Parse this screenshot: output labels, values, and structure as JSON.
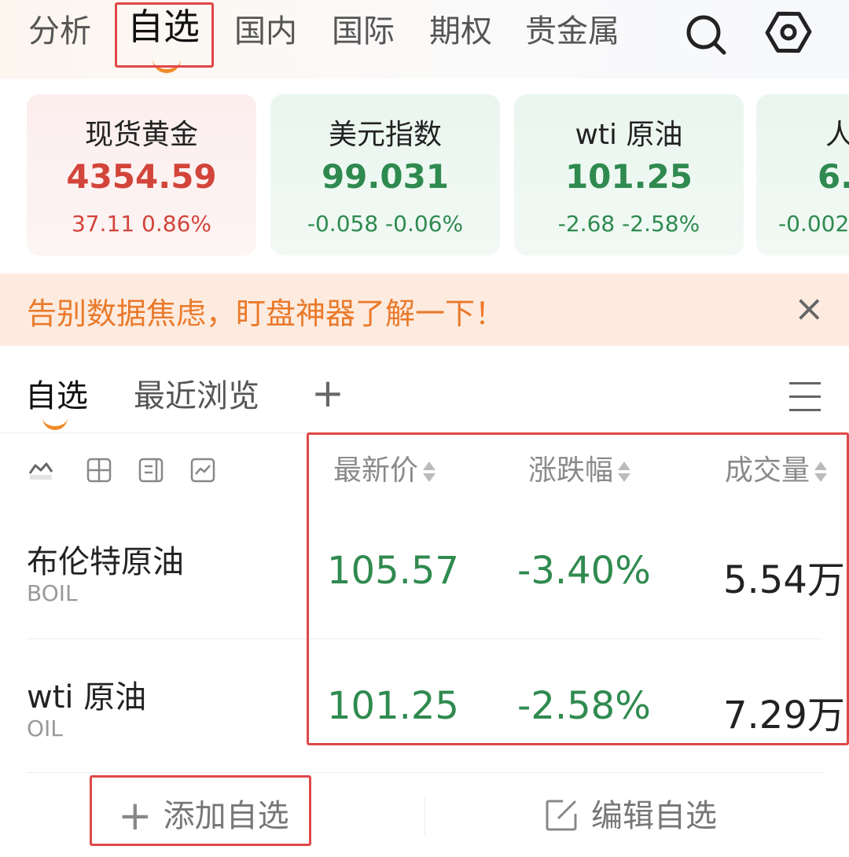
{
  "top_tabs": [
    {
      "label": "分析"
    },
    {
      "label": "自选"
    },
    {
      "label": "国内"
    },
    {
      "label": "国际"
    },
    {
      "label": "期权"
    },
    {
      "label": "贵金属"
    }
  ],
  "icons": {
    "search": "search-icon",
    "settings": "hexagon-settings-icon",
    "close": "close-icon",
    "menu": "menu-icon",
    "edit": "edit-icon"
  },
  "cards": [
    {
      "name": "现货黄金",
      "price": "4354.59",
      "change": "37.11  0.86%",
      "trend": "up"
    },
    {
      "name": "美元指数",
      "price": "99.031",
      "change": "-0.058  -0.06%",
      "trend": "down"
    },
    {
      "name": "wti 原油",
      "price": "101.25",
      "change": "-2.68  -2.58%",
      "trend": "down"
    },
    {
      "name": "人",
      "price": "6.",
      "change": "-0.002",
      "trend": "down"
    }
  ],
  "banner": {
    "text": "告别数据焦虑，盯盘神器了解一下！",
    "close": "×"
  },
  "sub_tabs": [
    {
      "label": "自选"
    },
    {
      "label": "最近浏览"
    }
  ],
  "add_tab": "+",
  "columns": [
    "最新价",
    "涨跌幅",
    "成交量"
  ],
  "rows": [
    {
      "name": "布伦特原油",
      "code": "BOIL",
      "price": "105.57",
      "change": "-3.40%",
      "volume": "5.54万"
    },
    {
      "name": "wti 原油",
      "code": "OIL",
      "price": "101.25",
      "change": "-2.58%",
      "volume": "7.29万"
    }
  ],
  "footer": {
    "add_label": "添加自选",
    "edit_label": "编辑自选",
    "plus": "+"
  },
  "colors": {
    "up": "#d2453a",
    "down": "#2f8a4f",
    "accent": "#f08a2a",
    "highlight": "#e04848",
    "banner_text": "#ea7a2b"
  }
}
